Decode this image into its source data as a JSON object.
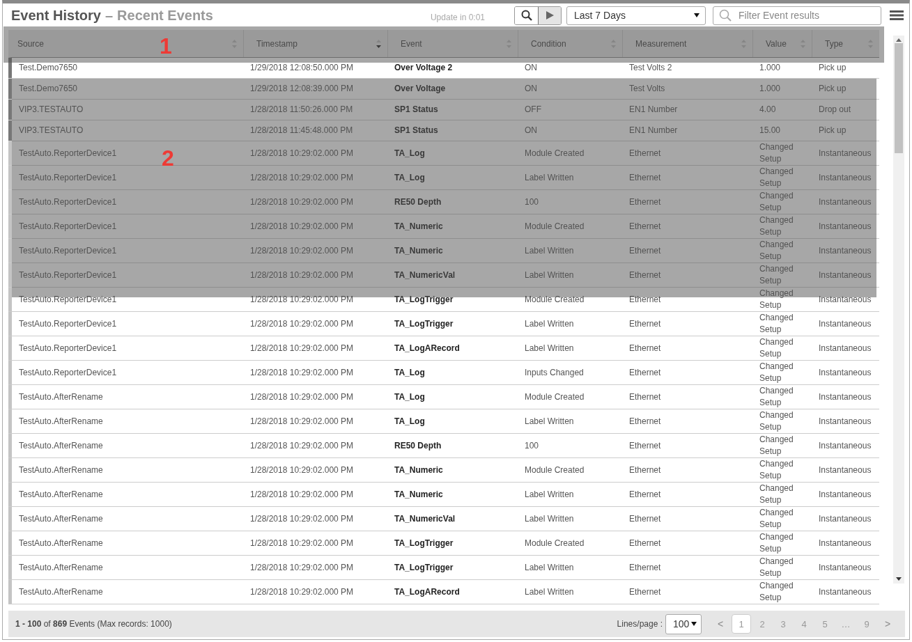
{
  "header": {
    "title": "Event History",
    "separator": "–",
    "subtitle": "Recent Events",
    "update": "Update in 0:01",
    "range": "Last 7 Days",
    "filter": {
      "placeholder": "Filter Event results"
    },
    "play_pressed": true
  },
  "table": {
    "columns": [
      {
        "label": "Source",
        "sorted": false
      },
      {
        "label": "Timestamp",
        "sorted": true
      },
      {
        "label": "Event",
        "sorted": false
      },
      {
        "label": "Condition",
        "sorted": false
      },
      {
        "label": "Measurement",
        "sorted": false
      },
      {
        "label": "Value",
        "sorted": false
      },
      {
        "label": "Type",
        "sorted": false
      }
    ],
    "rows": [
      {
        "new": true,
        "cells": [
          "Test.Demo7650",
          "1/29/2018 12:08:50.000 PM",
          "Over Voltage 2",
          "ON",
          "Test Volts 2",
          "1.000",
          "Pick up"
        ]
      },
      {
        "new": true,
        "cells": [
          "Test.Demo7650",
          "1/29/2018 12:08:39.000 PM",
          "Over Voltage",
          "ON",
          "Test Volts",
          "1.000",
          "Pick up"
        ]
      },
      {
        "new": true,
        "cells": [
          "VIP3.TESTAUTO",
          "1/28/2018 11:50:26.000 PM",
          "SP1 Status",
          "OFF",
          "EN1 Number",
          "4.00",
          "Drop out"
        ]
      },
      {
        "new": true,
        "cells": [
          "VIP3.TESTAUTO",
          "1/28/2018 11:45:48.000 PM",
          "SP1 Status",
          "ON",
          "EN1 Number",
          "15.00",
          "Pick up"
        ]
      },
      {
        "new": false,
        "cells": [
          "TestAuto.ReporterDevice1",
          "1/28/2018 10:29:02.000 PM",
          "TA_Log",
          "Module Created",
          "Ethernet",
          "Changed Setup",
          "Instantaneous"
        ]
      },
      {
        "new": false,
        "cells": [
          "TestAuto.ReporterDevice1",
          "1/28/2018 10:29:02.000 PM",
          "TA_Log",
          "Label Written",
          "Ethernet",
          "Changed Setup",
          "Instantaneous"
        ]
      },
      {
        "new": false,
        "cells": [
          "TestAuto.ReporterDevice1",
          "1/28/2018 10:29:02.000 PM",
          "RE50 Depth",
          "100",
          "Ethernet",
          "Changed Setup",
          "Instantaneous"
        ]
      },
      {
        "new": false,
        "cells": [
          "TestAuto.ReporterDevice1",
          "1/28/2018 10:29:02.000 PM",
          "TA_Numeric",
          "Module Created",
          "Ethernet",
          "Changed Setup",
          "Instantaneous"
        ]
      },
      {
        "new": false,
        "cells": [
          "TestAuto.ReporterDevice1",
          "1/28/2018 10:29:02.000 PM",
          "TA_Numeric",
          "Label Written",
          "Ethernet",
          "Changed Setup",
          "Instantaneous"
        ]
      },
      {
        "new": false,
        "cells": [
          "TestAuto.ReporterDevice1",
          "1/28/2018 10:29:02.000 PM",
          "TA_NumericVal",
          "Label Written",
          "Ethernet",
          "Changed Setup",
          "Instantaneous"
        ]
      },
      {
        "new": false,
        "cells": [
          "TestAuto.ReporterDevice1",
          "1/28/2018 10:29:02.000 PM",
          "TA_LogTrigger",
          "Module Created",
          "Ethernet",
          "Changed Setup",
          "Instantaneous"
        ]
      },
      {
        "new": false,
        "cells": [
          "TestAuto.ReporterDevice1",
          "1/28/2018 10:29:02.000 PM",
          "TA_LogTrigger",
          "Label Written",
          "Ethernet",
          "Changed Setup",
          "Instantaneous"
        ]
      },
      {
        "new": false,
        "cells": [
          "TestAuto.ReporterDevice1",
          "1/28/2018 10:29:02.000 PM",
          "TA_LogARecord",
          "Label Written",
          "Ethernet",
          "Changed Setup",
          "Instantaneous"
        ]
      },
      {
        "new": false,
        "cells": [
          "TestAuto.ReporterDevice1",
          "1/28/2018 10:29:02.000 PM",
          "TA_Log",
          "Inputs Changed",
          "Ethernet",
          "Changed Setup",
          "Instantaneous"
        ]
      },
      {
        "new": false,
        "cells": [
          "TestAuto.AfterRename",
          "1/28/2018 10:29:02.000 PM",
          "TA_Log",
          "Module Created",
          "Ethernet",
          "Changed Setup",
          "Instantaneous"
        ]
      },
      {
        "new": false,
        "cells": [
          "TestAuto.AfterRename",
          "1/28/2018 10:29:02.000 PM",
          "TA_Log",
          "Label Written",
          "Ethernet",
          "Changed Setup",
          "Instantaneous"
        ]
      },
      {
        "new": false,
        "cells": [
          "TestAuto.AfterRename",
          "1/28/2018 10:29:02.000 PM",
          "RE50 Depth",
          "100",
          "Ethernet",
          "Changed Setup",
          "Instantaneous"
        ]
      },
      {
        "new": false,
        "cells": [
          "TestAuto.AfterRename",
          "1/28/2018 10:29:02.000 PM",
          "TA_Numeric",
          "Module Created",
          "Ethernet",
          "Changed Setup",
          "Instantaneous"
        ]
      },
      {
        "new": false,
        "cells": [
          "TestAuto.AfterRename",
          "1/28/2018 10:29:02.000 PM",
          "TA_Numeric",
          "Label Written",
          "Ethernet",
          "Changed Setup",
          "Instantaneous"
        ]
      },
      {
        "new": false,
        "cells": [
          "TestAuto.AfterRename",
          "1/28/2018 10:29:02.000 PM",
          "TA_NumericVal",
          "Label Written",
          "Ethernet",
          "Changed Setup",
          "Instantaneous"
        ]
      },
      {
        "new": false,
        "cells": [
          "TestAuto.AfterRename",
          "1/28/2018 10:29:02.000 PM",
          "TA_LogTrigger",
          "Module Created",
          "Ethernet",
          "Changed Setup",
          "Instantaneous"
        ]
      },
      {
        "new": false,
        "cells": [
          "TestAuto.AfterRename",
          "1/28/2018 10:29:02.000 PM",
          "TA_LogTrigger",
          "Label Written",
          "Ethernet",
          "Changed Setup",
          "Instantaneous"
        ]
      },
      {
        "new": false,
        "cells": [
          "TestAuto.AfterRename",
          "1/28/2018 10:29:02.000 PM",
          "TA_LogARecord",
          "Label Written",
          "Ethernet",
          "Changed Setup",
          "Instantaneous"
        ]
      }
    ]
  },
  "callouts": [
    {
      "label": "1"
    },
    {
      "label": "2"
    }
  ],
  "footer": {
    "summary": "**1 - 100** of **869** Events (Max records: 1000)",
    "lines_label": "Lines/page :",
    "lines_value": "100",
    "pages": [
      {
        "label": "<",
        "kind": "nav",
        "selected": false
      },
      {
        "label": "1",
        "kind": "page",
        "selected": true
      },
      {
        "label": "2",
        "kind": "page",
        "selected": false
      },
      {
        "label": "3",
        "kind": "page",
        "selected": false
      },
      {
        "label": "4",
        "kind": "page",
        "selected": false
      },
      {
        "label": "5",
        "kind": "page",
        "selected": false
      },
      {
        "label": "…",
        "kind": "gap",
        "selected": false
      },
      {
        "label": "9",
        "kind": "page",
        "selected": false
      },
      {
        "label": ">",
        "kind": "nav",
        "selected": false
      }
    ]
  }
}
